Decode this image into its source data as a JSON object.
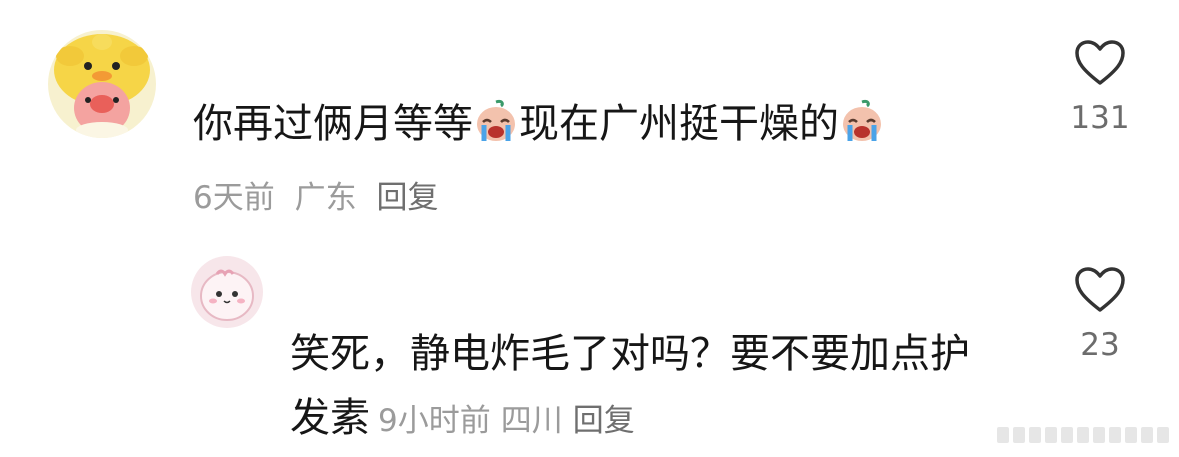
{
  "comments": [
    {
      "text_part1": "你再过俩月等等",
      "emoji1": "crying-face-emoji",
      "text_part2": "现在广州挺干燥的",
      "emoji2": "crying-face-emoji",
      "time": "6天前",
      "location": "广东",
      "reply_label": "回复",
      "likes": "131",
      "avatar": "yellow-duck-hat-avatar"
    },
    {
      "text_line1": "笑死，静电炸毛了对吗？要不要加点护",
      "text_line2": "发素",
      "time": "9小时前",
      "location": "四川",
      "reply_label": "回复",
      "likes": "23",
      "avatar": "pink-blob-avatar"
    }
  ],
  "icons": {
    "like": "heart-outline-icon"
  },
  "colors": {
    "text": "#161616",
    "meta": "#9b9b9b",
    "reply": "#6f6f6f",
    "count": "#6c6c6c",
    "icon": "#333333"
  }
}
